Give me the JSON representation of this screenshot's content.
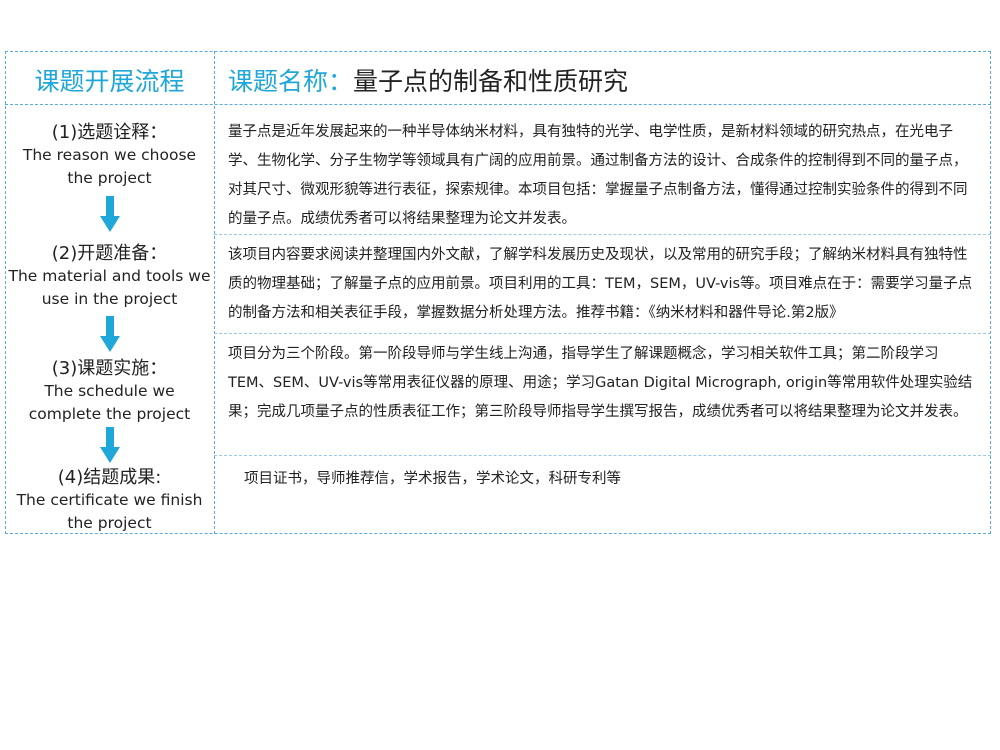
{
  "header": {
    "left": "课题开展流程",
    "right_label": "课题名称：",
    "right_topic": "量子点的制备和性质研究"
  },
  "steps": [
    {
      "title": "(1)选题诠释：",
      "sub1": "The reason we choose",
      "sub2": "the project"
    },
    {
      "title": "(2)开题准备：",
      "sub1": "The material and tools we",
      "sub2": "use in the project"
    },
    {
      "title": "(3)课题实施：",
      "sub1": "The schedule we",
      "sub2": "complete the project"
    },
    {
      "title": "(4)结题成果:",
      "sub1": "The certificate we finish",
      "sub2": "the project"
    }
  ],
  "details": [
    "量子点是近年发展起来的一种半导体纳米材料，具有独特的光学、电学性质，是新材料领域的研究热点，在光电子学、生物化学、分子生物学等领域具有广阔的应用前景。通过制备方法的设计、合成条件的控制得到不同的量子点，对其尺寸、微观形貌等进行表征，探索规律。本项目包括：掌握量子点制备方法，懂得通过控制实验条件的得到不同的量子点。成绩优秀者可以将结果整理为论文并发表。",
    "该项目内容要求阅读并整理国内外文献，了解学科发展历史及现状，以及常用的研究手段；了解纳米材料具有独特性质的物理基础；了解量子点的应用前景。项目利用的工具：TEM，SEM，UV-vis等。项目难点在于：需要学习量子点的制备方法和相关表征手段，掌握数据分析处理方法。推荐书籍：《纳米材料和器件导论.第2版》",
    "项目分为三个阶段。第一阶段导师与学生线上沟通，指导学生了解课题概念，学习相关软件工具；第二阶段学习TEM、SEM、UV-vis等常用表征仪器的原理、用途；学习Gatan Digital Micrograph, origin等常用软件处理实验结果；完成几项量子点的性质表征工作；第三阶段导师指导学生撰写报告，成绩优秀者可以将结果整理为论文并发表。",
    "项目证书，导师推荐信，学术报告，学术论文，科研专利等"
  ],
  "colors": {
    "accent": "#1ea7d8",
    "border": "#5aa9e0"
  },
  "icons": [
    "arrow-down-icon",
    "arrow-down-icon",
    "arrow-down-icon"
  ]
}
